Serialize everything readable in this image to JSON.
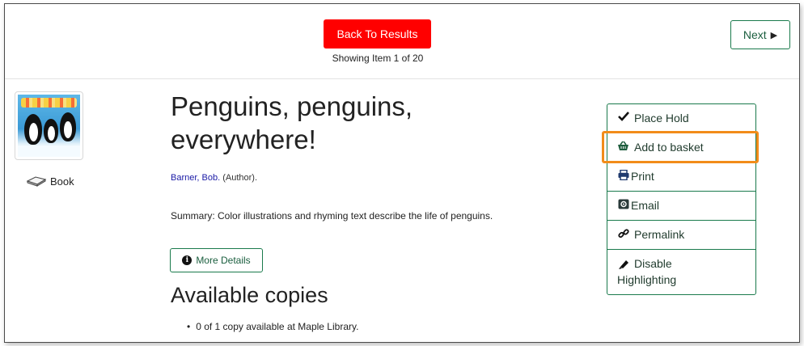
{
  "nav": {
    "back_label": "Back To Results",
    "showing_text": "Showing Item 1 of 20",
    "next_label": "Next",
    "next_icon": "play-triangle-icon"
  },
  "record": {
    "format_label": "Book",
    "title_line1": "Penguins, penguins,",
    "title_line2": "everywhere!",
    "author_name": "Barner, Bob.",
    "author_role": "(Author).",
    "summary": "Summary: Color illustrations and rhyming text describe the life of penguins.",
    "more_details_label": "More Details"
  },
  "availability": {
    "heading": "Available copies",
    "items": [
      "0 of 1 copy available at Maple Library."
    ]
  },
  "actions": {
    "place_hold": "Place Hold",
    "add_to_basket": "Add to basket",
    "print": "Print",
    "email": "Email",
    "permalink": "Permalink",
    "disable_line1": "Disable",
    "disable_line2": "Highlighting"
  },
  "colors": {
    "back_button": "#ff0000",
    "accent_green": "#1a7a4c",
    "highlight_orange": "#f28c1a",
    "link_blue": "#1a1aa6"
  }
}
